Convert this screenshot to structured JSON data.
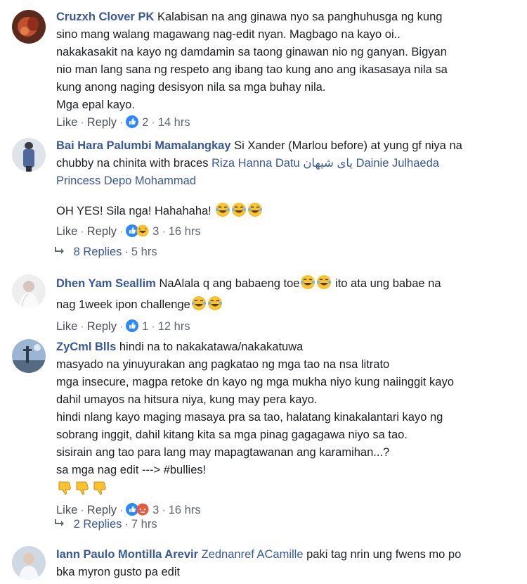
{
  "comments": [
    {
      "author": "Cruzxh Clover PK",
      "text_lines": [
        "Kalabisan na ang ginawa nyo sa panghuhusga ng kung",
        "sino mang walang magawang nag-edit nyan. Magbago na kayo oi..",
        "nakakasakit na kayo ng damdamin sa taong ginawan nio ng ganyan. Bigyan",
        "nio man lang sana ng respeto ang ibang tao kung ano ang ikasasaya nila sa",
        "kung anong naging desisyon nila sa mga buhay nila.",
        "Mga epal kayo."
      ],
      "like": "Like",
      "reply": "Reply",
      "reaction_count": "2",
      "time": "14 hrs"
    },
    {
      "author": "Bai Hara Palumbi Mamalangkay",
      "text_first": "Si Xander (Marlou before) at yung gf niya na",
      "text_second": "chubby na chinita with braces",
      "tag1": "Riza Hanna Datu",
      "tag2": "یای شیهان",
      "tag3": "Dainie Julhaeda",
      "tag4": "Princess Depo Mohammad",
      "text_extra": "OH YES! Sila nga! Hahahaha!",
      "like": "Like",
      "reply": "Reply",
      "reaction_count": "3",
      "time": "16 hrs",
      "replies_label": "8 Replies",
      "replies_time": "5 hrs"
    },
    {
      "author": "Dhen Yam Seallim",
      "text_first": "NaAlala q ang babaeng toe",
      "text_mid": "ito ata ung babae na",
      "text_second": "nag 1week ipon challenge",
      "like": "Like",
      "reply": "Reply",
      "reaction_count": "1",
      "time": "12 hrs"
    },
    {
      "author": "ZyCml Blls",
      "text_lines": [
        "hindi na to nakakatawa/nakakatuwa",
        "masyado na yinuyurakan ang pagkatao ng mga tao na nsa litrato",
        "mga insecure, magpa retoke dn kayo ng mga mukha niyo kung naiinggit kayo",
        "dahil umayos na hitsura niya, kung may pera kayo.",
        "hindi nlang kayo maging masaya pra sa tao, halatang kinakalantari kayo ng",
        "sobrang inggit, dahil kitang kita sa mga pinag gagagawa niyo sa tao.",
        "sisirain ang tao para lang may mapagtawanan ang karamihan...?",
        "sa mga nag edit ---> #bullies!"
      ],
      "like": "Like",
      "reply": "Reply",
      "reaction_count": "3",
      "time": "16 hrs",
      "replies_label": "2 Replies",
      "replies_time": "7 hrs"
    },
    {
      "author": "Iann Paulo Montilla Arevir",
      "tag1": "Zednanref ACamille",
      "text_first": "paki tag nrin ung fwens mo po",
      "text_second": "bka myron gusto pa edit"
    }
  ],
  "separator": "·",
  "colors": {
    "link": "#385898",
    "meta": "#606770",
    "like_blue": "#2d88ff",
    "haha_yellow": "#f7c331",
    "angry_red": "#e9573f"
  }
}
